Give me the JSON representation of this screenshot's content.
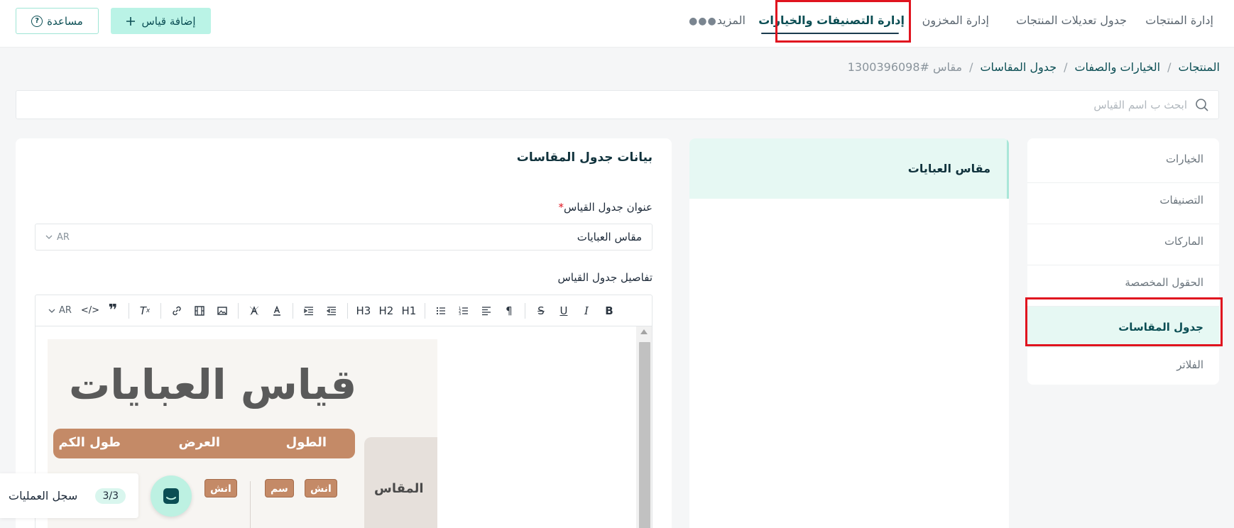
{
  "topnav": {
    "items": [
      "إدارة المنتجات",
      "جدول تعديلات المنتجات",
      "إدارة المخزون",
      "إدارة التصنيفات والخيارات"
    ],
    "more_label": "المزيد",
    "add_button": "إضافة قياس",
    "help_button": "مساعدة"
  },
  "breadcrumb": {
    "items": [
      "المنتجات",
      "الخيارات والصفات",
      "جدول المقاسات"
    ],
    "current": "مقاس #1300396098",
    "separator": "/"
  },
  "search": {
    "placeholder": "ابحث ب اسم القياس"
  },
  "sidebar": {
    "items": [
      "الخيارات",
      "التصنيفات",
      "الماركات",
      "الحقول المخصصة",
      "جدول المقاسات",
      "الفلاتر"
    ],
    "active": "جدول المقاسات"
  },
  "size_list": {
    "items": [
      "مقاس العبايات"
    ]
  },
  "form": {
    "title": "بيانات جدول المقاسات",
    "name_label": "عنوان جدول القياس",
    "required_mark": "*",
    "name_value": "مقاس العبايات",
    "lang": "AR",
    "details_label": "تفاصيل جدول القياس",
    "editor_lang": "AR",
    "toolbar": [
      "B",
      "I",
      "U",
      "S",
      "¶",
      "H1",
      "H2",
      "H3"
    ]
  },
  "size_chart_image": {
    "title": "قياس العبايات",
    "columns": [
      "الطول",
      "العرض",
      "طول الكم"
    ],
    "row_header": "المقاس",
    "chips": [
      "انش",
      "سم",
      "انش"
    ]
  },
  "ops_log": {
    "label": "سجل العمليات",
    "count": "3/3"
  },
  "colors": {
    "accent": "#0b4e54",
    "mint": "#baf3e6",
    "highlight": "#e0141f"
  }
}
